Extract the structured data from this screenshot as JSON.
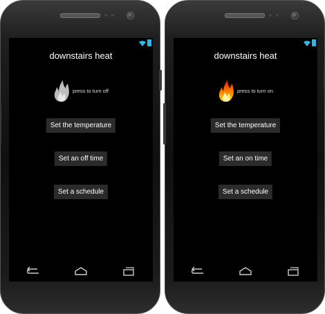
{
  "screens": [
    {
      "title": "downstairs heat",
      "flame_state": "off",
      "press_text": "press to turn off",
      "buttons": [
        "Set the temperature",
        "Set an off time",
        "Set a schedule"
      ]
    },
    {
      "title": "downstairs heat",
      "flame_state": "on",
      "press_text": "press to turn on",
      "buttons": [
        "Set the temperature",
        "Set an on time",
        "Set a schedule"
      ]
    }
  ],
  "icons": {
    "wifi": "wifi-icon",
    "battery": "battery-icon",
    "flame_off": "flame-off-icon",
    "flame_on": "flame-on-icon",
    "back": "back-icon",
    "home": "home-icon",
    "recents": "recents-icon"
  },
  "colors": {
    "accent": "#33b5e5",
    "flame_gray": "#bdbdbd",
    "flame_orange": "#ff7a00",
    "flame_yellow": "#ffd200"
  }
}
